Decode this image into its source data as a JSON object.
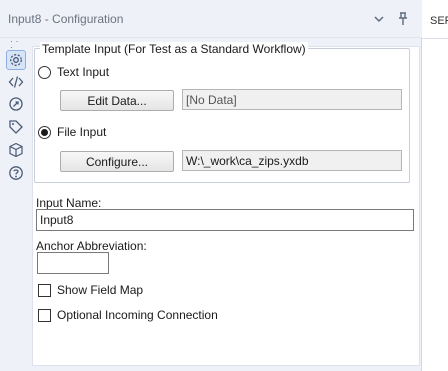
{
  "window": {
    "title": "Input8 - Configuration",
    "right_panel_label": "SER"
  },
  "toolbar": {
    "tools": [
      {
        "icon": "gear-icon",
        "active": true
      },
      {
        "icon": "code-icon",
        "active": false
      },
      {
        "icon": "annotation-icon",
        "active": false
      },
      {
        "icon": "tag-icon",
        "active": false
      },
      {
        "icon": "cube-icon",
        "active": false
      },
      {
        "icon": "help-icon",
        "active": false
      }
    ]
  },
  "template_input": {
    "legend": "Template Input (For Test as a Standard Workflow)",
    "text_input": {
      "label": "Text Input",
      "selected": false,
      "button_label": "Edit Data...",
      "value": "[No Data]"
    },
    "file_input": {
      "label": "File Input",
      "selected": true,
      "button_label": "Configure...",
      "value": "W:\\_work\\ca_zips.yxdb"
    }
  },
  "input_name": {
    "label": "Input Name:",
    "value": "Input8"
  },
  "anchor_abbreviation": {
    "label": "Anchor Abbreviation:",
    "value": ""
  },
  "options": {
    "show_field_map": {
      "label": "Show Field Map",
      "checked": false
    },
    "optional_incoming": {
      "label": "Optional Incoming Connection",
      "checked": false
    }
  }
}
